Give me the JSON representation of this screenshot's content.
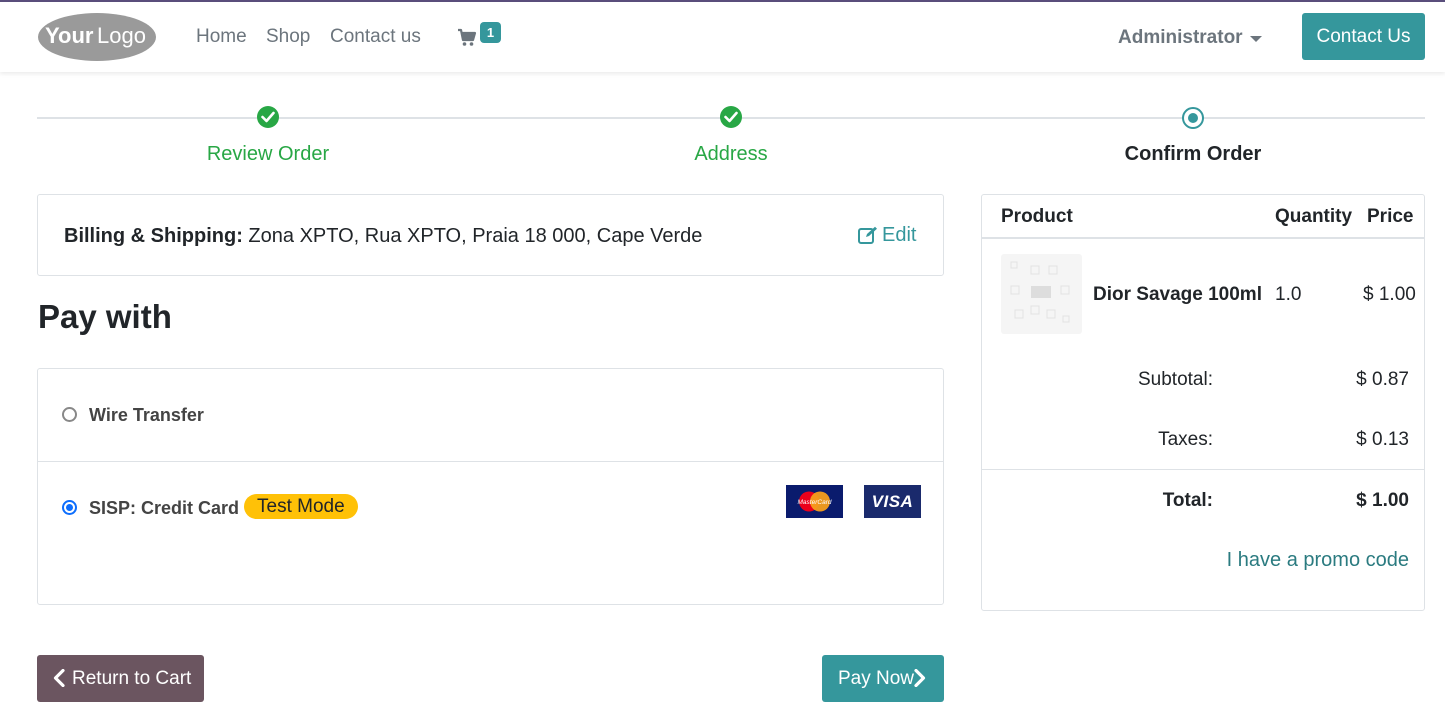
{
  "colors": {
    "accent": "#35979c",
    "success": "#28a745",
    "badge_yellow": "#ffc107",
    "return_button": "#6b5560"
  },
  "header": {
    "logo_text": "YourLogo",
    "nav": [
      "Home",
      "Shop",
      "Contact us"
    ],
    "cart_icon": "shopping-cart-icon",
    "cart_count": "1",
    "user_menu": "Administrator",
    "contact_button": "Contact Us"
  },
  "progress": {
    "steps": [
      {
        "label": "Review Order",
        "state": "done"
      },
      {
        "label": "Address",
        "state": "done"
      },
      {
        "label": "Confirm Order",
        "state": "current"
      }
    ]
  },
  "billing": {
    "label": "Billing & Shipping:",
    "address": "Zona XPTO, Rua XPTO, Praia 18 000, Cape Verde",
    "edit_label": "Edit"
  },
  "payment": {
    "title": "Pay with",
    "methods": [
      {
        "label": "Wire Transfer",
        "selected": false
      },
      {
        "label": "SISP: Credit Card",
        "selected": true,
        "badge": "Test Mode",
        "card_brands": [
          "mastercard",
          "visa"
        ]
      }
    ],
    "visa_text": "VISA",
    "mastercard_text": "MasterCard"
  },
  "actions": {
    "return_label": "Return to Cart",
    "pay_label": "Pay Now"
  },
  "summary": {
    "columns": [
      "Product",
      "Quantity",
      "Price"
    ],
    "items": [
      {
        "name": "Dior Savage 100ml",
        "quantity": "1.0",
        "price": "$ 1.00"
      }
    ],
    "subtotal_label": "Subtotal:",
    "subtotal": "$ 0.87",
    "taxes_label": "Taxes:",
    "taxes": "$ 0.13",
    "total_label": "Total:",
    "total": "$ 1.00",
    "promo_link": "I have a promo code"
  }
}
